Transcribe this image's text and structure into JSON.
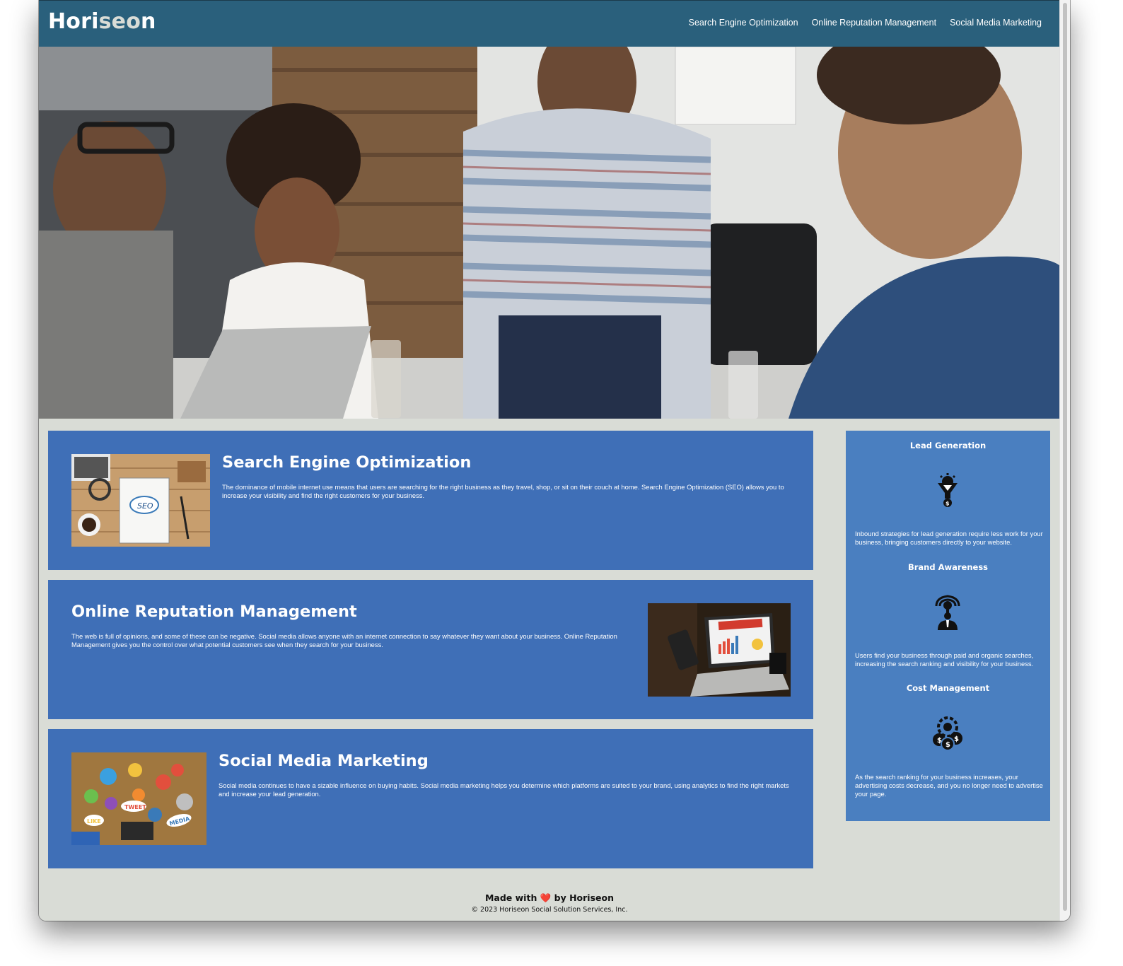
{
  "header": {
    "logo_prefix": "Hori",
    "logo_seo": "seo",
    "logo_suffix": "n",
    "nav": [
      {
        "label": "Search Engine Optimization"
      },
      {
        "label": "Online Reputation Management"
      },
      {
        "label": "Social Media Marketing"
      }
    ]
  },
  "hero": {
    "image": "team-meeting-photo"
  },
  "content": [
    {
      "title": "Search Engine Optimization",
      "text": "The dominance of mobile internet use means that users are searching for the right business as they travel, shop, or sit on their couch at home. Search Engine Optimization (SEO) allows you to increase your visibility and find the right customers for your business.",
      "image": "seo-desk-image"
    },
    {
      "title": "Online Reputation Management",
      "text": "The web is full of opinions, and some of these can be negative. Social media allows anyone with an internet connection to say whatever they want about your business. Online Reputation Management gives you the control over what potential customers see when they search for your business.",
      "image": "reputation-laptop-image"
    },
    {
      "title": "Social Media Marketing",
      "text": "Social media continues to have a sizable influence on buying habits. Social media marketing helps you determine which platforms are suited to your brand, using analytics to find the right markets and increase your lead generation.",
      "image": "social-media-table-image"
    }
  ],
  "benefits": [
    {
      "title": "Lead Generation",
      "icon": "lead-generation-icon",
      "text": "Inbound strategies for lead generation require less work for your business, bringing customers directly to your website."
    },
    {
      "title": "Brand Awareness",
      "icon": "brand-awareness-icon",
      "text": "Users find your business through paid and organic searches, increasing the search ranking and visibility for your business."
    },
    {
      "title": "Cost Management",
      "icon": "cost-management-icon",
      "text": "As the search ranking for your business increases, your advertising costs decrease, and you no longer need to advertise your page."
    }
  ],
  "footer": {
    "made_prefix": "Made with",
    "heart": "❤️",
    "made_suffix": "by Horiseon",
    "copyright": "© 2023 Horiseon Social Solution Services, Inc."
  },
  "colors": {
    "header_bg": "#2a607c",
    "card_bg": "#3f6fb7",
    "sidebar_bg": "#4a7fc0",
    "page_bg": "#d9dcd6",
    "logo_accent": "#d9dcd6"
  }
}
